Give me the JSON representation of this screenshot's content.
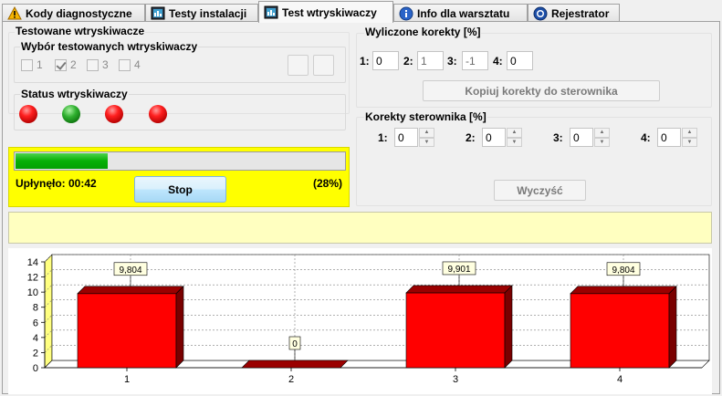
{
  "tabs": [
    {
      "label": "Kody diagnostyczne",
      "icon": "warning-icon",
      "active": false
    },
    {
      "label": "Testy instalacji",
      "icon": "monitor-icon",
      "active": false
    },
    {
      "label": "Test wtryskiwaczy",
      "icon": "monitor-icon",
      "active": true
    },
    {
      "label": "Info dla warsztatu",
      "icon": "info-icon",
      "active": false
    },
    {
      "label": "Rejestrator",
      "icon": "recorder-icon",
      "active": false
    }
  ],
  "tested": {
    "title": "Testowane wtryskiwacze",
    "selection_title": "Wybór testowanych wtryskiwaczy",
    "checkboxes": [
      {
        "label": "1",
        "checked": false
      },
      {
        "label": "2",
        "checked": true
      },
      {
        "label": "3",
        "checked": false
      },
      {
        "label": "4",
        "checked": false
      }
    ],
    "status_title": "Status wtryskiwaczy",
    "status": [
      "red",
      "green",
      "red",
      "red"
    ]
  },
  "progress": {
    "value": 28,
    "elapsed_label": "Upłynęło: 00:42",
    "percent_label": "(28%)",
    "stop_label": "Stop"
  },
  "calc": {
    "title": "Wyliczone korekty [%]",
    "fields": [
      {
        "label": "1:",
        "value": "0"
      },
      {
        "label": "2:",
        "value": "1"
      },
      {
        "label": "3:",
        "value": "-1"
      },
      {
        "label": "4:",
        "value": "0"
      }
    ],
    "copy_label": "Kopiuj korekty do sterownika"
  },
  "controller": {
    "title": "Korekty sterownika [%]",
    "fields": [
      {
        "label": "1:",
        "value": "0"
      },
      {
        "label": "2:",
        "value": "0"
      },
      {
        "label": "3:",
        "value": "0"
      },
      {
        "label": "4:",
        "value": "0"
      }
    ],
    "clear_label": "Wyczyść"
  },
  "colors": {
    "bar": "#ff0000",
    "bar_dark": "#9a0000",
    "progress": "#06b006",
    "highlight": "#ffff00"
  },
  "chart_data": {
    "type": "bar",
    "categories": [
      "1",
      "2",
      "3",
      "4"
    ],
    "values": [
      9.804,
      0,
      9.901,
      9.804
    ],
    "data_labels": [
      "9,804",
      "0",
      "9,901",
      "9,804"
    ],
    "yticks": [
      "0",
      "2",
      "4",
      "6",
      "8",
      "10",
      "12",
      "14"
    ],
    "ylim": [
      0,
      14
    ],
    "grid": true,
    "style": "3d"
  }
}
